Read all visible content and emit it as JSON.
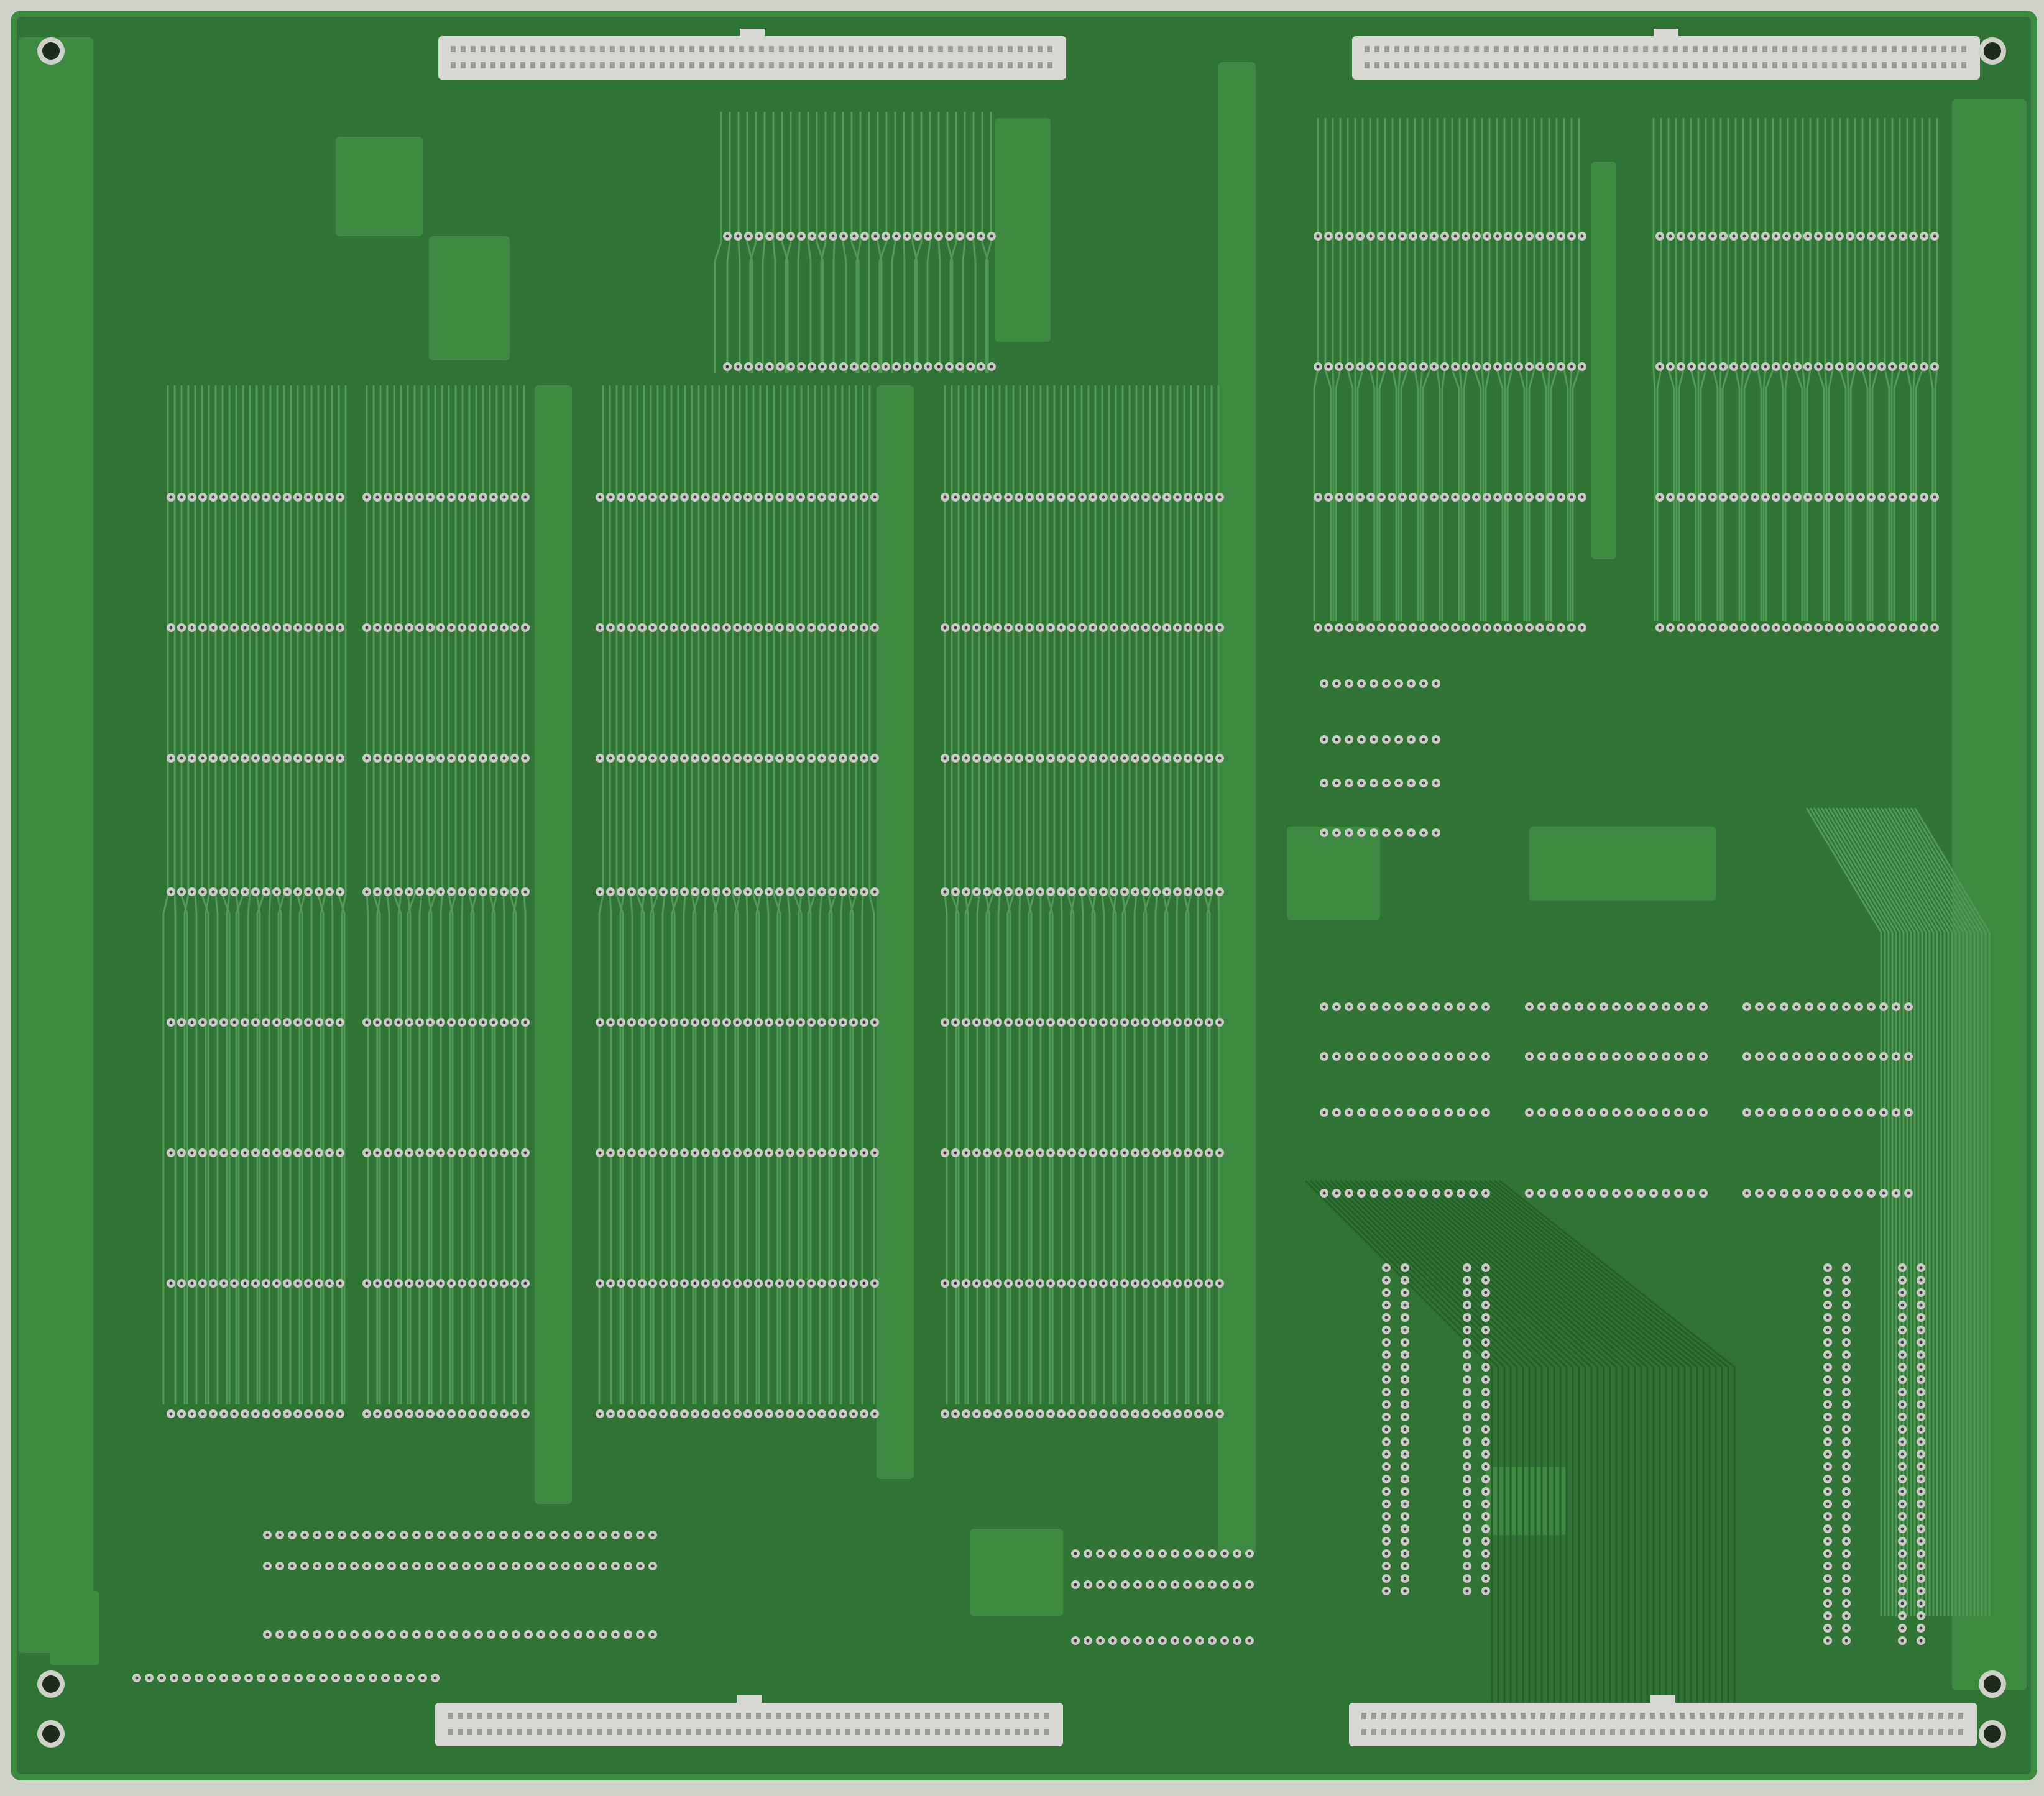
{
  "image": {
    "subject": "",
    "colors": {
      "background": "#cfd2c9",
      "board": "#2f7434",
      "board_edge": "#3d8a3f",
      "trace": "#4f9a55",
      "trace_dark": "#246029",
      "plane": "#3c8940",
      "pad": "#c9cbc4",
      "pad_hole": "#3a3f3a",
      "connector": "#d7d8d3",
      "connector_pin": "#9a9c98",
      "mount_hole": "#1e2a1e"
    },
    "connectors": [
      {
        "name": "top-left-connector"
      },
      {
        "name": "top-right-connector"
      },
      {
        "name": "bottom-left-connector"
      },
      {
        "name": "bottom-right-connector"
      }
    ],
    "mounting_holes": 6
  }
}
